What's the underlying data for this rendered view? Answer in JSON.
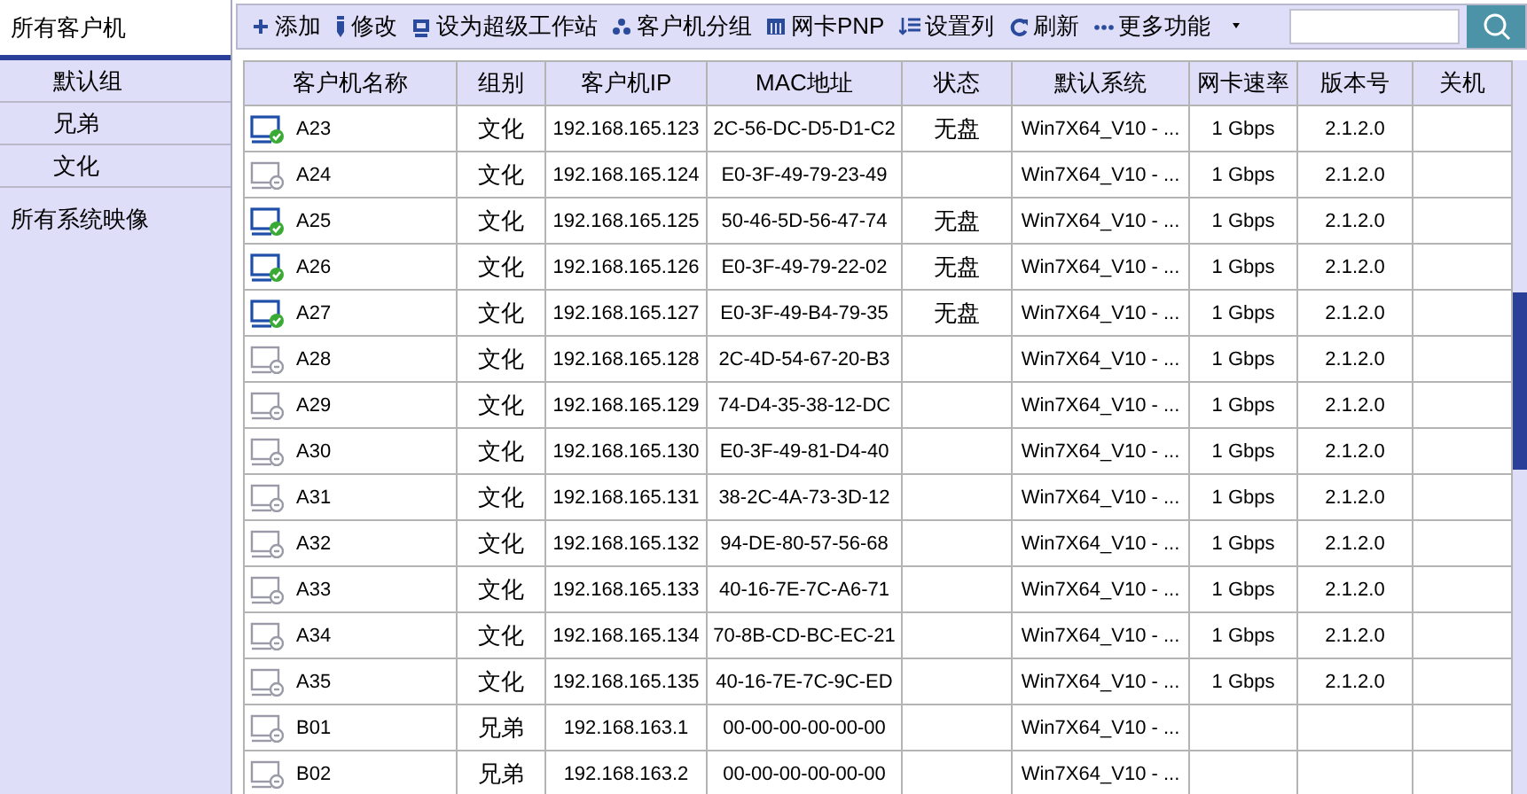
{
  "sidebar": {
    "items": [
      {
        "label": "所有客户机",
        "selected": true,
        "children": [
          {
            "label": "默认组",
            "selected": false
          },
          {
            "label": "兄弟",
            "selected": false
          },
          {
            "label": "文化",
            "selected": false
          }
        ]
      },
      {
        "label": "所有系统映像",
        "selected": false
      }
    ]
  },
  "toolbar": {
    "buttons": [
      {
        "label": "添加",
        "kind": "plus"
      },
      {
        "label": "修改",
        "kind": "pen"
      },
      {
        "label": "设为超级工作站",
        "kind": "monitor"
      },
      {
        "label": "客户机分组",
        "kind": "dots"
      },
      {
        "label": "网卡PNP",
        "kind": "card"
      },
      {
        "label": "设置列",
        "kind": "list"
      },
      {
        "label": "刷新",
        "kind": "refresh"
      },
      {
        "label": "更多功能",
        "kind": "more",
        "dropdown": true
      }
    ]
  },
  "table": {
    "columns": [
      "客户机名称",
      "组别",
      "客户机IP",
      "MAC地址",
      "状态",
      "默认系统",
      "网卡速率",
      "版本号",
      "关机"
    ],
    "rows": [
      {
        "online": true,
        "cells": [
          "A23",
          "文化",
          "192.168.165.123",
          "2C-56-DC-D5-D1-C2",
          "无盘",
          "Win7X64_V10 - ...",
          "1 Gbps",
          "2.1.2.0"
        ]
      },
      {
        "online": false,
        "cells": [
          "A24",
          "文化",
          "192.168.165.124",
          "E0-3F-49-79-23-49",
          "",
          "Win7X64_V10 - ...",
          "1 Gbps",
          "2.1.2.0"
        ]
      },
      {
        "online": true,
        "cells": [
          "A25",
          "文化",
          "192.168.165.125",
          "50-46-5D-56-47-74",
          "无盘",
          "Win7X64_V10 - ...",
          "1 Gbps",
          "2.1.2.0"
        ]
      },
      {
        "online": true,
        "cells": [
          "A26",
          "文化",
          "192.168.165.126",
          "E0-3F-49-79-22-02",
          "无盘",
          "Win7X64_V10 - ...",
          "1 Gbps",
          "2.1.2.0"
        ]
      },
      {
        "online": true,
        "cells": [
          "A27",
          "文化",
          "192.168.165.127",
          "E0-3F-49-B4-79-35",
          "无盘",
          "Win7X64_V10 - ...",
          "1 Gbps",
          "2.1.2.0"
        ]
      },
      {
        "online": false,
        "cells": [
          "A28",
          "文化",
          "192.168.165.128",
          "2C-4D-54-67-20-B3",
          "",
          "Win7X64_V10 - ...",
          "1 Gbps",
          "2.1.2.0"
        ]
      },
      {
        "online": false,
        "cells": [
          "A29",
          "文化",
          "192.168.165.129",
          "74-D4-35-38-12-DC",
          "",
          "Win7X64_V10 - ...",
          "1 Gbps",
          "2.1.2.0"
        ]
      },
      {
        "online": false,
        "cells": [
          "A30",
          "文化",
          "192.168.165.130",
          "E0-3F-49-81-D4-40",
          "",
          "Win7X64_V10 - ...",
          "1 Gbps",
          "2.1.2.0"
        ]
      },
      {
        "online": false,
        "cells": [
          "A31",
          "文化",
          "192.168.165.131",
          "38-2C-4A-73-3D-12",
          "",
          "Win7X64_V10 - ...",
          "1 Gbps",
          "2.1.2.0"
        ]
      },
      {
        "online": false,
        "cells": [
          "A32",
          "文化",
          "192.168.165.132",
          "94-DE-80-57-56-68",
          "",
          "Win7X64_V10 - ...",
          "1 Gbps",
          "2.1.2.0"
        ]
      },
      {
        "online": false,
        "cells": [
          "A33",
          "文化",
          "192.168.165.133",
          "40-16-7E-7C-A6-71",
          "",
          "Win7X64_V10 - ...",
          "1 Gbps",
          "2.1.2.0"
        ]
      },
      {
        "online": false,
        "cells": [
          "A34",
          "文化",
          "192.168.165.134",
          "70-8B-CD-BC-EC-21",
          "",
          "Win7X64_V10 - ...",
          "1 Gbps",
          "2.1.2.0"
        ]
      },
      {
        "online": false,
        "cells": [
          "A35",
          "文化",
          "192.168.165.135",
          "40-16-7E-7C-9C-ED",
          "",
          "Win7X64_V10 - ...",
          "1 Gbps",
          "2.1.2.0"
        ]
      },
      {
        "online": false,
        "cells": [
          "B01",
          "兄弟",
          "192.168.163.1",
          "00-00-00-00-00-00",
          "",
          "Win7X64_V10 - ..."
        ]
      },
      {
        "online": false,
        "cells": [
          "B02",
          "兄弟",
          "192.168.163.2",
          "00-00-00-00-00-00",
          "",
          "Win7X64_V10 - ..."
        ]
      }
    ]
  }
}
